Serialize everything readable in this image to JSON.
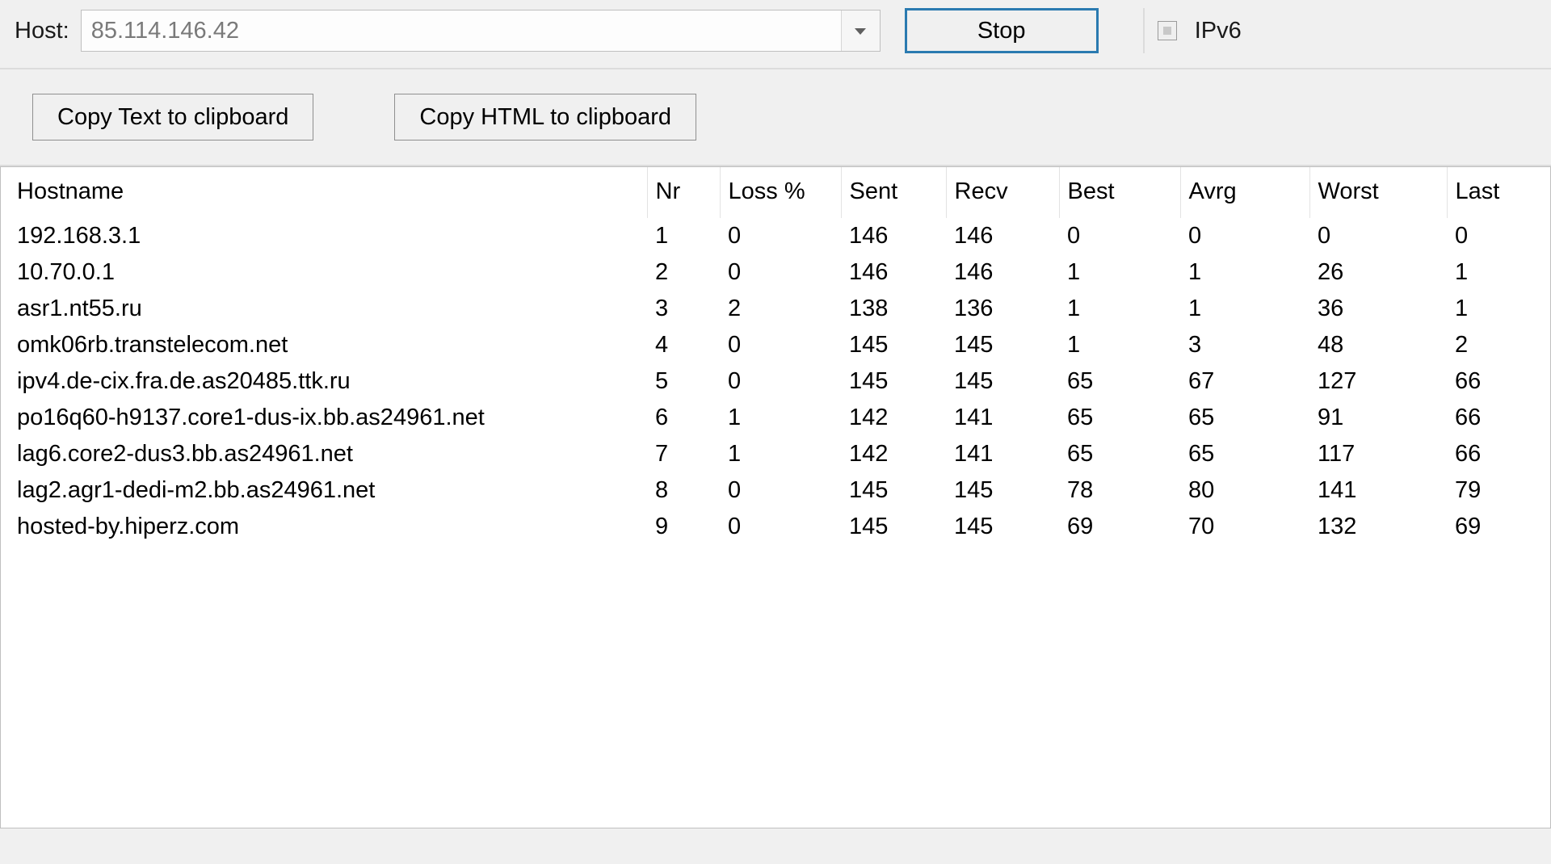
{
  "top": {
    "host_label": "Host:",
    "host_value": "85.114.146.42",
    "stop_label": "Stop",
    "ipv6_label": "IPv6",
    "ipv6_checked": false
  },
  "copy": {
    "copy_text_label": "Copy Text to clipboard",
    "copy_html_label": "Copy HTML to clipboard"
  },
  "table": {
    "headers": {
      "hostname": "Hostname",
      "nr": "Nr",
      "loss": "Loss %",
      "sent": "Sent",
      "recv": "Recv",
      "best": "Best",
      "avrg": "Avrg",
      "worst": "Worst",
      "last": "Last"
    },
    "rows": [
      {
        "hostname": "192.168.3.1",
        "nr": "1",
        "loss": "0",
        "sent": "146",
        "recv": "146",
        "best": "0",
        "avrg": "0",
        "worst": "0",
        "last": "0"
      },
      {
        "hostname": "10.70.0.1",
        "nr": "2",
        "loss": "0",
        "sent": "146",
        "recv": "146",
        "best": "1",
        "avrg": "1",
        "worst": "26",
        "last": "1"
      },
      {
        "hostname": "asr1.nt55.ru",
        "nr": "3",
        "loss": "2",
        "sent": "138",
        "recv": "136",
        "best": "1",
        "avrg": "1",
        "worst": "36",
        "last": "1"
      },
      {
        "hostname": "omk06rb.transtelecom.net",
        "nr": "4",
        "loss": "0",
        "sent": "145",
        "recv": "145",
        "best": "1",
        "avrg": "3",
        "worst": "48",
        "last": "2"
      },
      {
        "hostname": "ipv4.de-cix.fra.de.as20485.ttk.ru",
        "nr": "5",
        "loss": "0",
        "sent": "145",
        "recv": "145",
        "best": "65",
        "avrg": "67",
        "worst": "127",
        "last": "66"
      },
      {
        "hostname": "po16q60-h9137.core1-dus-ix.bb.as24961.net",
        "nr": "6",
        "loss": "1",
        "sent": "142",
        "recv": "141",
        "best": "65",
        "avrg": "65",
        "worst": "91",
        "last": "66"
      },
      {
        "hostname": "lag6.core2-dus3.bb.as24961.net",
        "nr": "7",
        "loss": "1",
        "sent": "142",
        "recv": "141",
        "best": "65",
        "avrg": "65",
        "worst": "117",
        "last": "66"
      },
      {
        "hostname": "lag2.agr1-dedi-m2.bb.as24961.net",
        "nr": "8",
        "loss": "0",
        "sent": "145",
        "recv": "145",
        "best": "78",
        "avrg": "80",
        "worst": "141",
        "last": "79"
      },
      {
        "hostname": "hosted-by.hiperz.com",
        "nr": "9",
        "loss": "0",
        "sent": "145",
        "recv": "145",
        "best": "69",
        "avrg": "70",
        "worst": "132",
        "last": "69"
      }
    ]
  }
}
